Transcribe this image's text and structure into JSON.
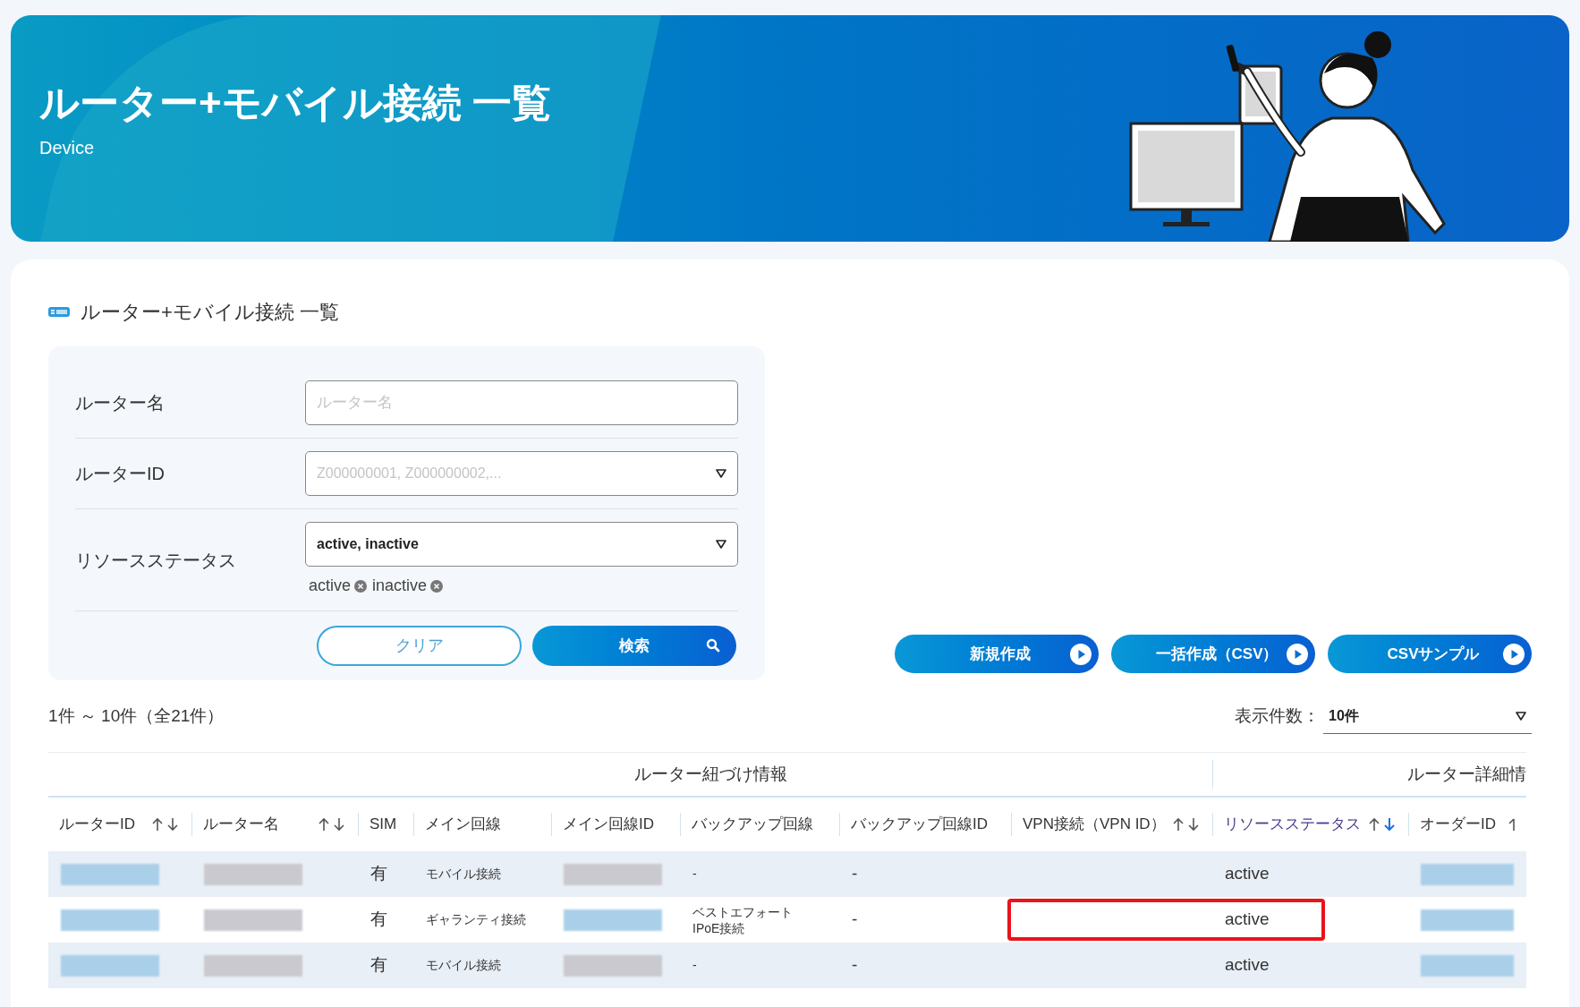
{
  "banner": {
    "title": "ルーター+モバイル接続 一覧",
    "subtitle": "Device"
  },
  "section_title": "ルーター+モバイル接続 一覧",
  "filters": [
    {
      "kind": "text",
      "label": "ルーター名",
      "placeholder": "ルーター名"
    },
    {
      "kind": "select",
      "label": "ルーターID",
      "placeholder": "Z000000001, Z000000002,..."
    },
    {
      "kind": "select",
      "label": "リソースステータス",
      "value": "active, inactive",
      "tags": [
        "active",
        "inactive"
      ]
    }
  ],
  "filter_buttons": [
    {
      "kind": "outline",
      "label": "クリア"
    },
    {
      "kind": "search",
      "label": "検索"
    }
  ],
  "actions": [
    "新規作成",
    "一括作成（CSV）",
    "CSVサンプル"
  ],
  "result_count": "1件 ～ 10件（全21件）",
  "page_size": {
    "label": "表示件数：",
    "value": "10件"
  },
  "table": {
    "groups": [
      "ルーター紐づけ情報",
      "ルーター詳細情"
    ],
    "columns": [
      {
        "label": "ルーターID",
        "kind": "sortable"
      },
      {
        "label": "ルーター名",
        "kind": "sortable"
      },
      {
        "label": "SIM",
        "kind": "plain"
      },
      {
        "label": "メイン回線",
        "kind": "plain"
      },
      {
        "label": "メイン回線ID",
        "kind": "plain"
      },
      {
        "label": "バックアップ回線",
        "kind": "plain"
      },
      {
        "label": "バックアップ回線ID",
        "kind": "plain"
      },
      {
        "label": "VPN接続（VPN ID）",
        "kind": "sortable"
      },
      {
        "label": "リソースステータス",
        "kind": "sorted"
      },
      {
        "label": "オーダーID",
        "kind": "clipped"
      }
    ],
    "rows": [
      {
        "highlighted": false,
        "cells": [
          {
            "kind": "redacted",
            "link": true
          },
          {
            "kind": "redacted",
            "link": false
          },
          {
            "kind": "text",
            "text": "有"
          },
          {
            "kind": "small",
            "text": "モバイル接続"
          },
          {
            "kind": "redacted",
            "link": false
          },
          {
            "kind": "small",
            "text": "-"
          },
          {
            "kind": "text",
            "text": "-"
          },
          {
            "kind": "empty"
          },
          {
            "kind": "text",
            "text": "active"
          },
          {
            "kind": "redacted",
            "link": true
          }
        ]
      },
      {
        "highlighted": true,
        "cells": [
          {
            "kind": "redacted",
            "link": true
          },
          {
            "kind": "redacted",
            "link": false
          },
          {
            "kind": "text",
            "text": "有"
          },
          {
            "kind": "small",
            "text": "ギャランティ接続"
          },
          {
            "kind": "redacted",
            "link": true
          },
          {
            "kind": "lines",
            "lines": [
              "ベストエフォート",
              "IPoE接続"
            ]
          },
          {
            "kind": "text",
            "text": "-"
          },
          {
            "kind": "empty"
          },
          {
            "kind": "text",
            "text": "active"
          },
          {
            "kind": "redacted",
            "link": true
          }
        ]
      },
      {
        "highlighted": false,
        "cells": [
          {
            "kind": "redacted",
            "link": true
          },
          {
            "kind": "redacted",
            "link": false
          },
          {
            "kind": "text",
            "text": "有"
          },
          {
            "kind": "small",
            "text": "モバイル接続"
          },
          {
            "kind": "redacted",
            "link": false
          },
          {
            "kind": "small",
            "text": "-"
          },
          {
            "kind": "text",
            "text": "-"
          },
          {
            "kind": "empty"
          },
          {
            "kind": "text",
            "text": "active"
          },
          {
            "kind": "redacted",
            "link": true
          }
        ]
      }
    ]
  }
}
